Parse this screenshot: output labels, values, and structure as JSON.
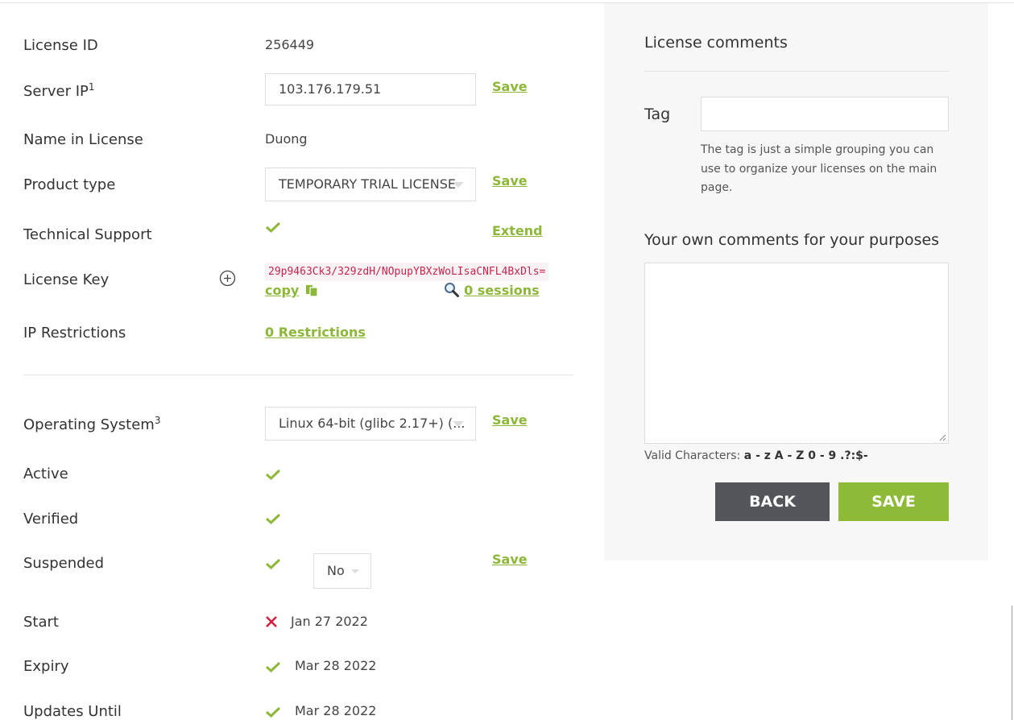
{
  "colors": {
    "accent_green": "#8db739",
    "error_red": "#d0223f",
    "back_button": "#53555a",
    "save_button": "#8dbb38",
    "code_text": "#c7254e"
  },
  "fields": {
    "license_id": {
      "label": "License ID",
      "value": "256449"
    },
    "server_ip": {
      "label": "Server IP",
      "sup": "1",
      "value": "103.176.179.51",
      "action": "Save"
    },
    "name_in_license": {
      "label": "Name in License",
      "value": "Duong"
    },
    "product_type": {
      "label": "Product type",
      "selected": "TEMPORARY TRIAL LICENSE",
      "action": "Save"
    },
    "technical_support": {
      "label": "Technical Support",
      "status_icon": "check-icon",
      "action": "Extend"
    },
    "license_key": {
      "label": "License Key",
      "expand_icon": "plus-circle-icon",
      "key": "29p9463Ck3/329zdH/NOpupYBXzWoLIsaCNFL4BxDls=",
      "copy_label": "copy",
      "copy_icon": "copy-icon",
      "sessions_icon": "magnifier-icon",
      "sessions_label": "0 sessions"
    },
    "ip_restrictions": {
      "label": "IP Restrictions",
      "link": "0 Restrictions"
    },
    "operating_system": {
      "label": "Operating System",
      "sup": "3",
      "selected": "Linux 64-bit (glibc 2.17+) (...",
      "action": "Save"
    },
    "active": {
      "label": "Active",
      "status_icon": "check-icon"
    },
    "verified": {
      "label": "Verified",
      "status_icon": "check-icon"
    },
    "suspended": {
      "label": "Suspended",
      "status_icon": "check-icon",
      "selected": "No",
      "action": "Save"
    },
    "start": {
      "label": "Start",
      "status_icon": "cross-icon",
      "date": "Jan 27 2022"
    },
    "expiry": {
      "label": "Expiry",
      "status_icon": "check-icon",
      "date": "Mar 28 2022"
    },
    "updates_until": {
      "label": "Updates Until",
      "status_icon": "check-icon",
      "date": "Mar 28 2022"
    }
  },
  "comments_panel": {
    "title": "License comments",
    "tag_label": "Tag",
    "tag_value": "",
    "tag_help": "The tag is just a simple grouping you can use to organize your licenses on the main page.",
    "comments_label": "Your own comments for your purposes",
    "comments_value": "",
    "valid_prefix": "Valid Characters:",
    "valid_chars": "a - z A - Z 0 - 9 .?:$-",
    "back_label": "BACK",
    "save_label": "SAVE"
  }
}
